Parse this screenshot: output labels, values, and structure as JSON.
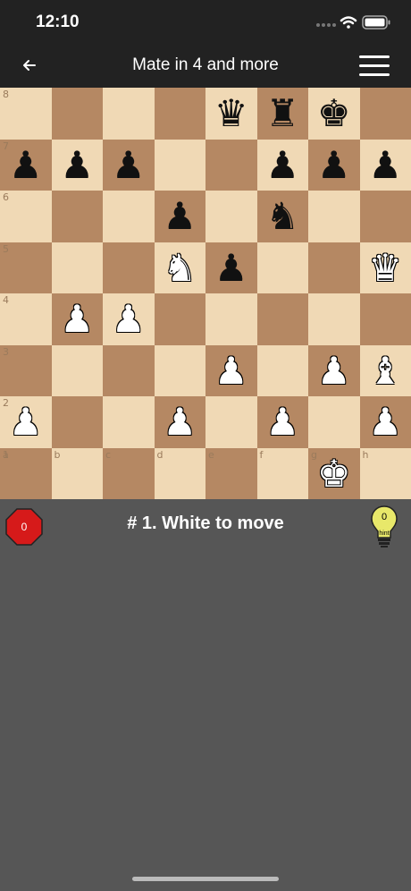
{
  "status_bar": {
    "time": "12:10"
  },
  "nav": {
    "title": "Mate in 4 and more",
    "back_icon": "arrow-left-icon",
    "menu_icon": "hamburger-menu-icon"
  },
  "board": {
    "ranks": [
      "8",
      "7",
      "6",
      "5",
      "4",
      "3",
      "2",
      "1"
    ],
    "files": [
      "a",
      "b",
      "c",
      "d",
      "e",
      "f",
      "g",
      "h"
    ],
    "position": [
      [
        "",
        "",
        "",
        "",
        "bq",
        "br",
        "bk",
        ""
      ],
      [
        "bp",
        "bp",
        "bp",
        "",
        "",
        "bp",
        "bp",
        "bp"
      ],
      [
        "",
        "",
        "",
        "bp",
        "",
        "bn",
        "",
        ""
      ],
      [
        "",
        "",
        "",
        "wn",
        "bp",
        "",
        "",
        "wq"
      ],
      [
        "",
        "wp",
        "wp",
        "",
        "",
        "",
        "",
        ""
      ],
      [
        "",
        "",
        "",
        "",
        "wp",
        "",
        "wp",
        "wb"
      ],
      [
        "wp",
        "",
        "",
        "wp",
        "",
        "wp",
        "",
        "wp"
      ],
      [
        "",
        "",
        "",
        "",
        "",
        "",
        "wk",
        ""
      ]
    ],
    "light_color": "#f0d9b5",
    "dark_color": "#b58863"
  },
  "footer": {
    "errors_count": "0",
    "turn_text": "# 1. White to move",
    "hint_count": "0",
    "hint_label": "hint",
    "errors_color": "#d61a1a",
    "hint_color": "#e8e86a"
  }
}
